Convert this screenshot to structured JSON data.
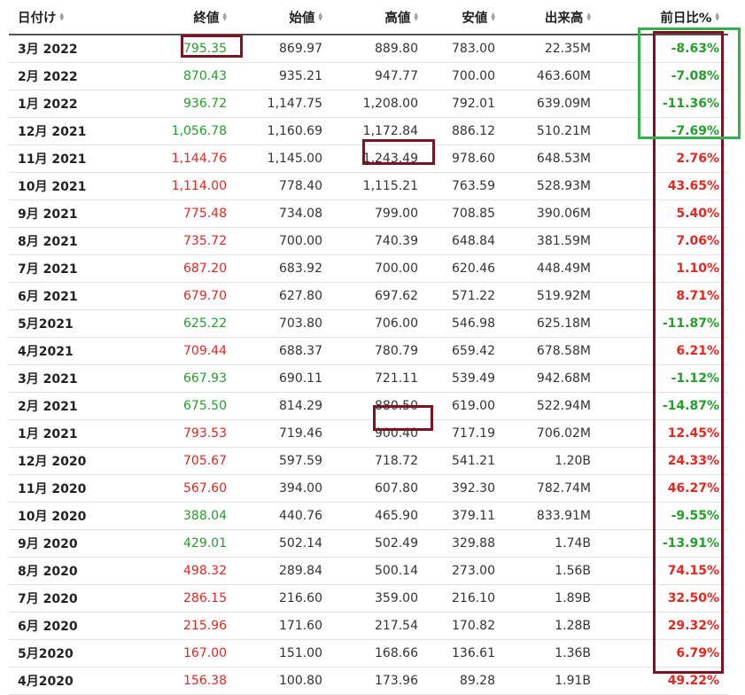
{
  "headers": [
    "日付け",
    "終値",
    "始値",
    "高値",
    "安値",
    "出来高",
    "前日比%"
  ],
  "colors": {
    "up": "#e8261f",
    "down": "#22a02a",
    "highlight_red": "#7a1420",
    "highlight_green": "#33b14a"
  },
  "rows": [
    {
      "date": "3月 2022",
      "close": "795.35",
      "open": "869.97",
      "high": "889.80",
      "low": "783.00",
      "volume": "22.35M",
      "change": "-8.63%",
      "dir": "down"
    },
    {
      "date": "2月 2022",
      "close": "870.43",
      "open": "935.21",
      "high": "947.77",
      "low": "700.00",
      "volume": "463.60M",
      "change": "-7.08%",
      "dir": "down"
    },
    {
      "date": "1月 2022",
      "close": "936.72",
      "open": "1,147.75",
      "high": "1,208.00",
      "low": "792.01",
      "volume": "639.09M",
      "change": "-11.36%",
      "dir": "down"
    },
    {
      "date": "12月 2021",
      "close": "1,056.78",
      "open": "1,160.69",
      "high": "1,172.84",
      "low": "886.12",
      "volume": "510.21M",
      "change": "-7.69%",
      "dir": "down"
    },
    {
      "date": "11月 2021",
      "close": "1,144.76",
      "open": "1,145.00",
      "high": "1,243.49",
      "low": "978.60",
      "volume": "648.53M",
      "change": "2.76%",
      "dir": "up"
    },
    {
      "date": "10月 2021",
      "close": "1,114.00",
      "open": "778.40",
      "high": "1,115.21",
      "low": "763.59",
      "volume": "528.93M",
      "change": "43.65%",
      "dir": "up"
    },
    {
      "date": "9月 2021",
      "close": "775.48",
      "open": "734.08",
      "high": "799.00",
      "low": "708.85",
      "volume": "390.06M",
      "change": "5.40%",
      "dir": "up"
    },
    {
      "date": "8月 2021",
      "close": "735.72",
      "open": "700.00",
      "high": "740.39",
      "low": "648.84",
      "volume": "381.59M",
      "change": "7.06%",
      "dir": "up"
    },
    {
      "date": "7月 2021",
      "close": "687.20",
      "open": "683.92",
      "high": "700.00",
      "low": "620.46",
      "volume": "448.49M",
      "change": "1.10%",
      "dir": "up"
    },
    {
      "date": "6月 2021",
      "close": "679.70",
      "open": "627.80",
      "high": "697.62",
      "low": "571.22",
      "volume": "519.92M",
      "change": "8.71%",
      "dir": "up"
    },
    {
      "date": "5月2021",
      "close": "625.22",
      "open": "703.80",
      "high": "706.00",
      "low": "546.98",
      "volume": "625.18M",
      "change": "-11.87%",
      "dir": "down"
    },
    {
      "date": "4月2021",
      "close": "709.44",
      "open": "688.37",
      "high": "780.79",
      "low": "659.42",
      "volume": "678.58M",
      "change": "6.21%",
      "dir": "up"
    },
    {
      "date": "3月 2021",
      "close": "667.93",
      "open": "690.11",
      "high": "721.11",
      "low": "539.49",
      "volume": "942.68M",
      "change": "-1.12%",
      "dir": "down"
    },
    {
      "date": "2月 2021",
      "close": "675.50",
      "open": "814.29",
      "high": "880.50",
      "low": "619.00",
      "volume": "522.94M",
      "change": "-14.87%",
      "dir": "down"
    },
    {
      "date": "1月 2021",
      "close": "793.53",
      "open": "719.46",
      "high": "900.40",
      "low": "717.19",
      "volume": "706.02M",
      "change": "12.45%",
      "dir": "up"
    },
    {
      "date": "12月 2020",
      "close": "705.67",
      "open": "597.59",
      "high": "718.72",
      "low": "541.21",
      "volume": "1.20B",
      "change": "24.33%",
      "dir": "up"
    },
    {
      "date": "11月 2020",
      "close": "567.60",
      "open": "394.00",
      "high": "607.80",
      "low": "392.30",
      "volume": "782.74M",
      "change": "46.27%",
      "dir": "up"
    },
    {
      "date": "10月 2020",
      "close": "388.04",
      "open": "440.76",
      "high": "465.90",
      "low": "379.11",
      "volume": "833.91M",
      "change": "-9.55%",
      "dir": "down"
    },
    {
      "date": "9月 2020",
      "close": "429.01",
      "open": "502.14",
      "high": "502.49",
      "low": "329.88",
      "volume": "1.74B",
      "change": "-13.91%",
      "dir": "down"
    },
    {
      "date": "8月 2020",
      "close": "498.32",
      "open": "289.84",
      "high": "500.14",
      "low": "273.00",
      "volume": "1.56B",
      "change": "74.15%",
      "dir": "up"
    },
    {
      "date": "7月 2020",
      "close": "286.15",
      "open": "216.60",
      "high": "359.00",
      "low": "216.10",
      "volume": "1.89B",
      "change": "32.50%",
      "dir": "up"
    },
    {
      "date": "6月 2020",
      "close": "215.96",
      "open": "171.60",
      "high": "217.54",
      "low": "170.82",
      "volume": "1.28B",
      "change": "29.32%",
      "dir": "up"
    },
    {
      "date": "5月2020",
      "close": "167.00",
      "open": "151.00",
      "high": "168.66",
      "low": "136.61",
      "volume": "1.36B",
      "change": "6.79%",
      "dir": "up"
    },
    {
      "date": "4月2020",
      "close": "156.38",
      "open": "100.80",
      "high": "173.96",
      "low": "89.28",
      "volume": "1.91B",
      "change": "49.22%",
      "dir": "up"
    }
  ]
}
